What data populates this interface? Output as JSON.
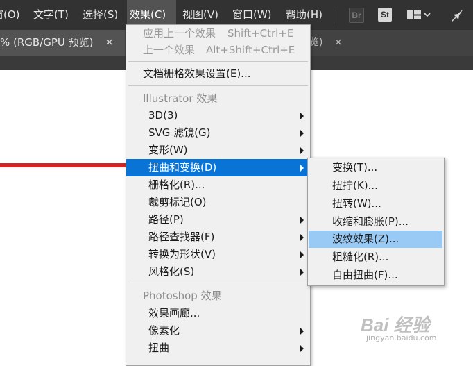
{
  "menubar": {
    "items": [
      {
        "label": "窗(O)"
      },
      {
        "label": "文字(T)"
      },
      {
        "label": "选择(S)"
      },
      {
        "label": "效果(C)"
      },
      {
        "label": "视图(V)"
      },
      {
        "label": "窗口(W)"
      },
      {
        "label": "帮助(H)"
      }
    ],
    "br_badge": "Br",
    "st_badge": "St"
  },
  "tabs": {
    "doc_label": "% (RGB/GPU 预览)",
    "close_glyph": "×",
    "tab2_label": "览)",
    "tab2_close": "×"
  },
  "effect_menu": {
    "items": [
      {
        "label": "应用上一个效果",
        "shortcut": "Shift+Ctrl+E"
      },
      {
        "label": "上一个效果",
        "shortcut": "Alt+Shift+Ctrl+E"
      },
      {
        "label": "文档栅格效果设置(E)..."
      },
      {
        "label": "Illustrator 效果"
      },
      {
        "label": "3D(3)"
      },
      {
        "label": "SVG 滤镜(G)"
      },
      {
        "label": "变形(W)"
      },
      {
        "label": "扭曲和变换(D)"
      },
      {
        "label": "栅格化(R)..."
      },
      {
        "label": "裁剪标记(O)"
      },
      {
        "label": "路径(P)"
      },
      {
        "label": "路径查找器(F)"
      },
      {
        "label": "转换为形状(V)"
      },
      {
        "label": "风格化(S)"
      },
      {
        "label": "Photoshop 效果"
      },
      {
        "label": "效果画廊..."
      },
      {
        "label": "像素化"
      },
      {
        "label": "扭曲"
      }
    ]
  },
  "distort_submenu": {
    "items": [
      {
        "label": "变换(T)..."
      },
      {
        "label": "扭拧(K)..."
      },
      {
        "label": "扭转(W)..."
      },
      {
        "label": "收缩和膨胀(P)..."
      },
      {
        "label": "波纹效果(Z)..."
      },
      {
        "label": "粗糙化(R)..."
      },
      {
        "label": "自由扭曲(F)..."
      }
    ]
  },
  "watermark": {
    "brand": "Bai 经验",
    "url": "jingyan.baidu.com"
  },
  "colors": {
    "menubar_bg": "#323232",
    "menu_bg": "#f0f0f0",
    "highlight": "#0a73d6",
    "sub_highlight": "#99c9f5",
    "artwork_line": "#e02020"
  }
}
